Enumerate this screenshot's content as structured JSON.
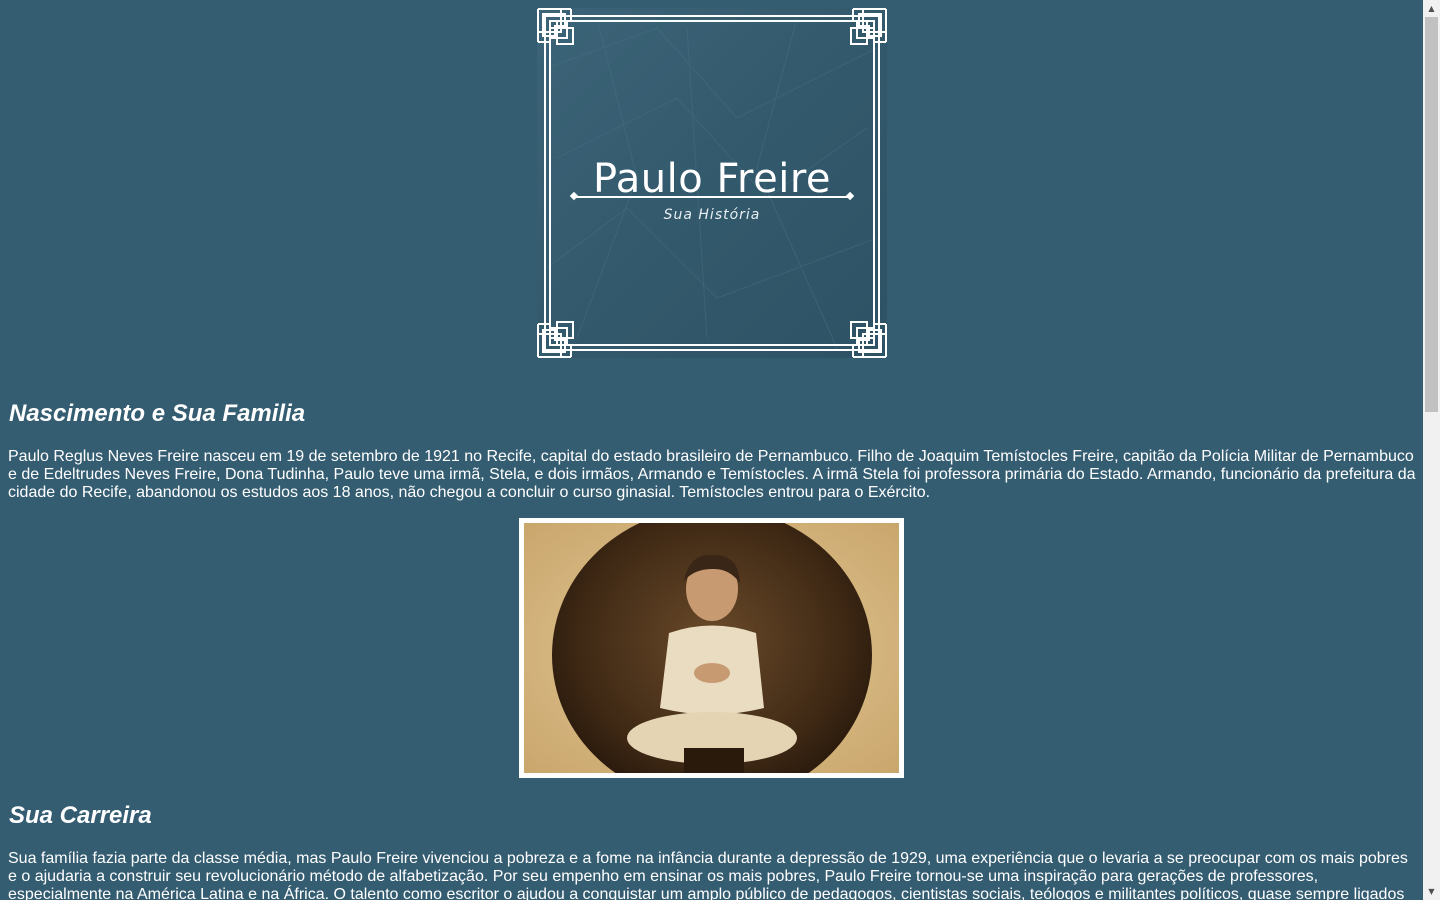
{
  "logo": {
    "title": "Paulo Freire",
    "subtitle": "Sua História"
  },
  "sections": [
    {
      "title": "Nascimento e Sua Familia",
      "text": "Paulo Reglus Neves Freire nasceu em 19 de setembro de 1921 no Recife, capital do estado brasileiro de Pernambuco. Filho de Joaquim Temístocles Freire, capitão da Polícia Militar de Pernambuco e de Edeltrudes Neves Freire, Dona Tudinha, Paulo teve uma irmã, Stela, e dois irmãos, Armando e Temístocles. A irmã Stela foi professora primária do Estado. Armando, funcionário da prefeitura da cidade do Recife, abandonou os estudos aos 18 anos, não chegou a concluir o curso ginasial. Temístocles entrou para o Exército."
    },
    {
      "title": "Sua Carreira",
      "text": "Sua família fazia parte da classe média, mas Paulo Freire vivenciou a pobreza e a fome na infância durante a depressão de 1929, uma experiência que o levaria a se preocupar com os mais pobres e o ajudaria a construir seu revolucionário método de alfabetização. Por seu empenho em ensinar os mais pobres, Paulo Freire tornou-se uma inspiração para gerações de professores, especialmente na América Latina e na África. O talento como escritor o ajudou a conquistar um amplo público de pedagogos, cientistas sociais, teólogos e militantes políticos, quase sempre ligados"
    }
  ],
  "colors": {
    "background": "#355d72",
    "text": "#ffffff",
    "scrollbar_track": "#f1f1f1",
    "scrollbar_thumb": "#c1c1c1"
  },
  "scrollbar": {
    "up_icon": "triangle-up-icon",
    "down_icon": "triangle-down-icon"
  }
}
